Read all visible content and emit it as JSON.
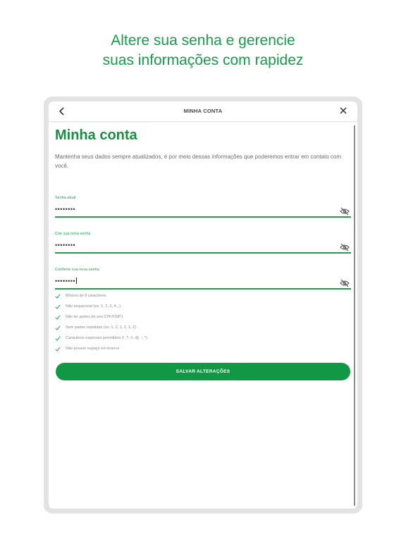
{
  "headline": {
    "line1": "Altere sua senha e gerencie",
    "line2": "suas informações com rapidez"
  },
  "topbar": {
    "back_icon": "chevron-left-icon",
    "title": "MINHA CONTA",
    "close_icon": "close-icon"
  },
  "page": {
    "title": "Minha conta",
    "intro": "Mantenha seus dados sempre atualizados, é por meio dessas informações que poderemos entrar em contato com você."
  },
  "fields": [
    {
      "label": "Senha atual",
      "value": "••••••••",
      "icon": "eye-off-icon"
    },
    {
      "label": "Crie sua nova senha",
      "value": "••••••••",
      "icon": "eye-off-icon"
    },
    {
      "label": "Confirme sua nova senha",
      "value": "••••••••",
      "icon": "eye-off-icon"
    }
  ],
  "rules": [
    "Mínimo de 8 caracteres",
    "Não sequencial (ex: 1, 2, 3, 4...)",
    "Não ter partes do seu CPF/CNPJ",
    "Sem partes repetidas (ex: 1, 2, 1, 2, 1, 2)",
    "Caracteres especiais permitidos (!, ?, #, @, -, *)",
    "Não possuir espaço em branco"
  ],
  "save_button": "SALVAR ALTERAÇÕES",
  "colors": {
    "brand_green": "#119844",
    "headline_green": "#12a04a",
    "label_green": "#22a04f",
    "frame_gray": "#e3e3e3"
  }
}
